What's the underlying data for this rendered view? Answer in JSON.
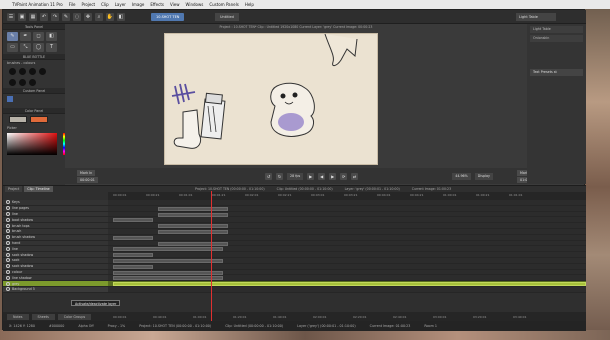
{
  "menubar": {
    "app": "TVPaint Animation 11 Pro",
    "items": [
      "File",
      "Project",
      "Clip",
      "Layer",
      "Image",
      "Effects",
      "View",
      "Windows",
      "Custom Panels",
      "Help"
    ],
    "title": "*/Volumes/2020/01.BLUE BOTTLE/08.TV PAINT/10.SHOT TEN.tvpp - TVPaint Animation 11 Pro STD (11.0.10-64 bits)"
  },
  "toolbar": {
    "tab_active": "10.SHOT TEN",
    "tab_untitled": "Untitled",
    "light_table": "Light Table"
  },
  "left_panels": {
    "tools_title": "Tools Panel",
    "panel2_title": "BLUE BOTTLE",
    "brush_label": "brushes - colours",
    "panel3_title": "Custom Panel",
    "color_panel_title": "Color Panel",
    "picker_label": "Picker"
  },
  "viewport": {
    "header": "Project : 10.SHOT TEN*  Clip : Untitled  1920x1080  Current Layer: 'grey'  Current Image: 00:00:23"
  },
  "viewport_controls": {
    "zoom": "28 fps",
    "mark_in": "Mark In",
    "mark_in_time": "00:00:01",
    "zoom_pct": "44.96%",
    "display": "Display",
    "mark_out": "Mark Out",
    "mark_out_time": "01:00:00"
  },
  "right_panel": {
    "items": [
      "Light Table",
      "Onionskin",
      "Text Presets st"
    ]
  },
  "timeline": {
    "tabs": [
      "Project",
      "Clip: Timeline"
    ],
    "info": [
      "Project: 10.SHOT TEN (00:00:00 - 01:10:00)",
      "Clip: Untitled (00:00:00 - 01:10:00)",
      "Layer: 'grey' (00:00:01 - 01:10:00)",
      "Current Image: 01:00:23"
    ],
    "ruler_ticks": [
      "00:00:01",
      "00:00:21",
      "00:01:01",
      "00:01:21",
      "00:02:01",
      "00:02:21",
      "00:03:01",
      "00:03:21",
      "00:04:01",
      "00:04:21",
      "01:00:01",
      "01:00:21",
      "01:01:01"
    ],
    "bottom_ticks": [
      "00:00:01",
      "00:40:01",
      "01:00:01",
      "01:20:01",
      "01:40:01",
      "02:00:01",
      "02:20:01",
      "02:40:01",
      "03:00:01",
      "03:20:01",
      "03:40:01"
    ],
    "layers": [
      {
        "name": "Keys",
        "sel": false
      },
      {
        "name": "line pages",
        "sel": false
      },
      {
        "name": "line",
        "sel": false
      },
      {
        "name": "boot shadow",
        "sel": false
      },
      {
        "name": "brush tops",
        "sel": false
      },
      {
        "name": "brush",
        "sel": false
      },
      {
        "name": "brush shadow",
        "sel": false
      },
      {
        "name": "hand",
        "sel": false
      },
      {
        "name": "line",
        "sel": false
      },
      {
        "name": "sock shadow",
        "sel": false
      },
      {
        "name": "sock",
        "sel": false
      },
      {
        "name": "sock shadow",
        "sel": false
      },
      {
        "name": "colour",
        "sel": false
      },
      {
        "name": "line shadow",
        "sel": false
      },
      {
        "name": "grey",
        "sel": true
      },
      {
        "name": "Background 5",
        "sel": false,
        "bg": true
      }
    ],
    "tooltip": "Activate/deactivate layer",
    "bottom_buttons": [
      "Notes",
      "Sheets",
      "Color Groups"
    ],
    "bg_buttons": [
      "Background",
      "Start Frame"
    ]
  },
  "statusbar": {
    "coords": "X: 1426  Y: 1280",
    "color": "#000000",
    "alpha": "Alpha Off",
    "proxy": "Proxy - 1%",
    "project": "Project: 10.SHOT TEN (00:00:00 - 01:10:00)",
    "clip": "Clip: Untitled (00:00:00 - 01:10:00)",
    "layer": "Layer ('grey') (00:00:01 - 01:10:00)",
    "image": "Current Image: 01:00:23",
    "page": "Room 1"
  }
}
